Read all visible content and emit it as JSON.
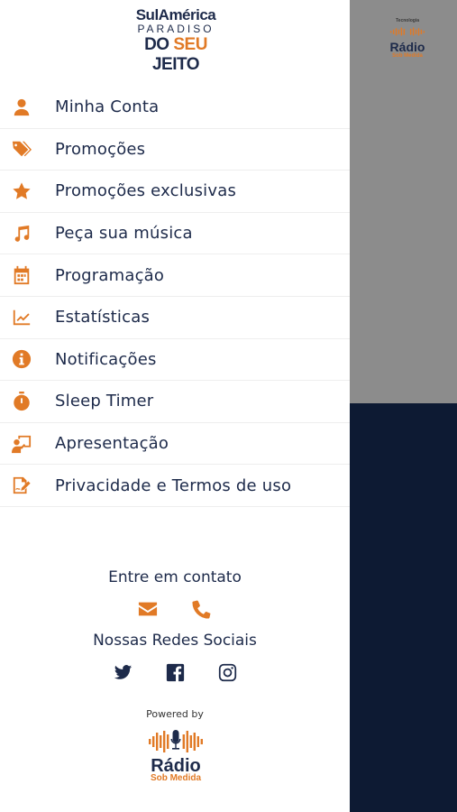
{
  "brand": {
    "line1": "SulAmérica",
    "line2": "PARADISO",
    "line3_a": "DO ",
    "line3_b": "SEU",
    "line3_c": " JEITO"
  },
  "background_logo": {
    "tag": "Tecnologia",
    "word": "Rádio",
    "sub": "Sob Medida"
  },
  "menu": [
    {
      "label": "Minha Conta",
      "icon": "user-icon"
    },
    {
      "label": "Promoções",
      "icon": "tags-icon"
    },
    {
      "label": "Promoções exclusivas",
      "icon": "star-icon"
    },
    {
      "label": "Peça sua música",
      "icon": "music-icon"
    },
    {
      "label": "Programação",
      "icon": "calendar-icon"
    },
    {
      "label": "Estatísticas",
      "icon": "chart-line-icon"
    },
    {
      "label": "Notificações",
      "icon": "info-icon"
    },
    {
      "label": "Sleep Timer",
      "icon": "stopwatch-icon"
    },
    {
      "label": "Apresentação",
      "icon": "presenter-icon"
    },
    {
      "label": "Privacidade e Termos de uso",
      "icon": "signature-icon"
    }
  ],
  "contact": {
    "title": "Entre em contato",
    "icons": [
      "envelope-icon",
      "phone-icon"
    ]
  },
  "social": {
    "title": "Nossas Redes Sociais",
    "icons": [
      "twitter-icon",
      "facebook-icon",
      "instagram-icon"
    ]
  },
  "footer": {
    "powered_by": "Powered by",
    "logo_word": "Rádio",
    "logo_sub": "Sob Medida"
  },
  "colors": {
    "accent": "#e17a26",
    "text": "#1d2a4a",
    "navy": "#0d1a33",
    "gray": "#8c8c8c"
  }
}
